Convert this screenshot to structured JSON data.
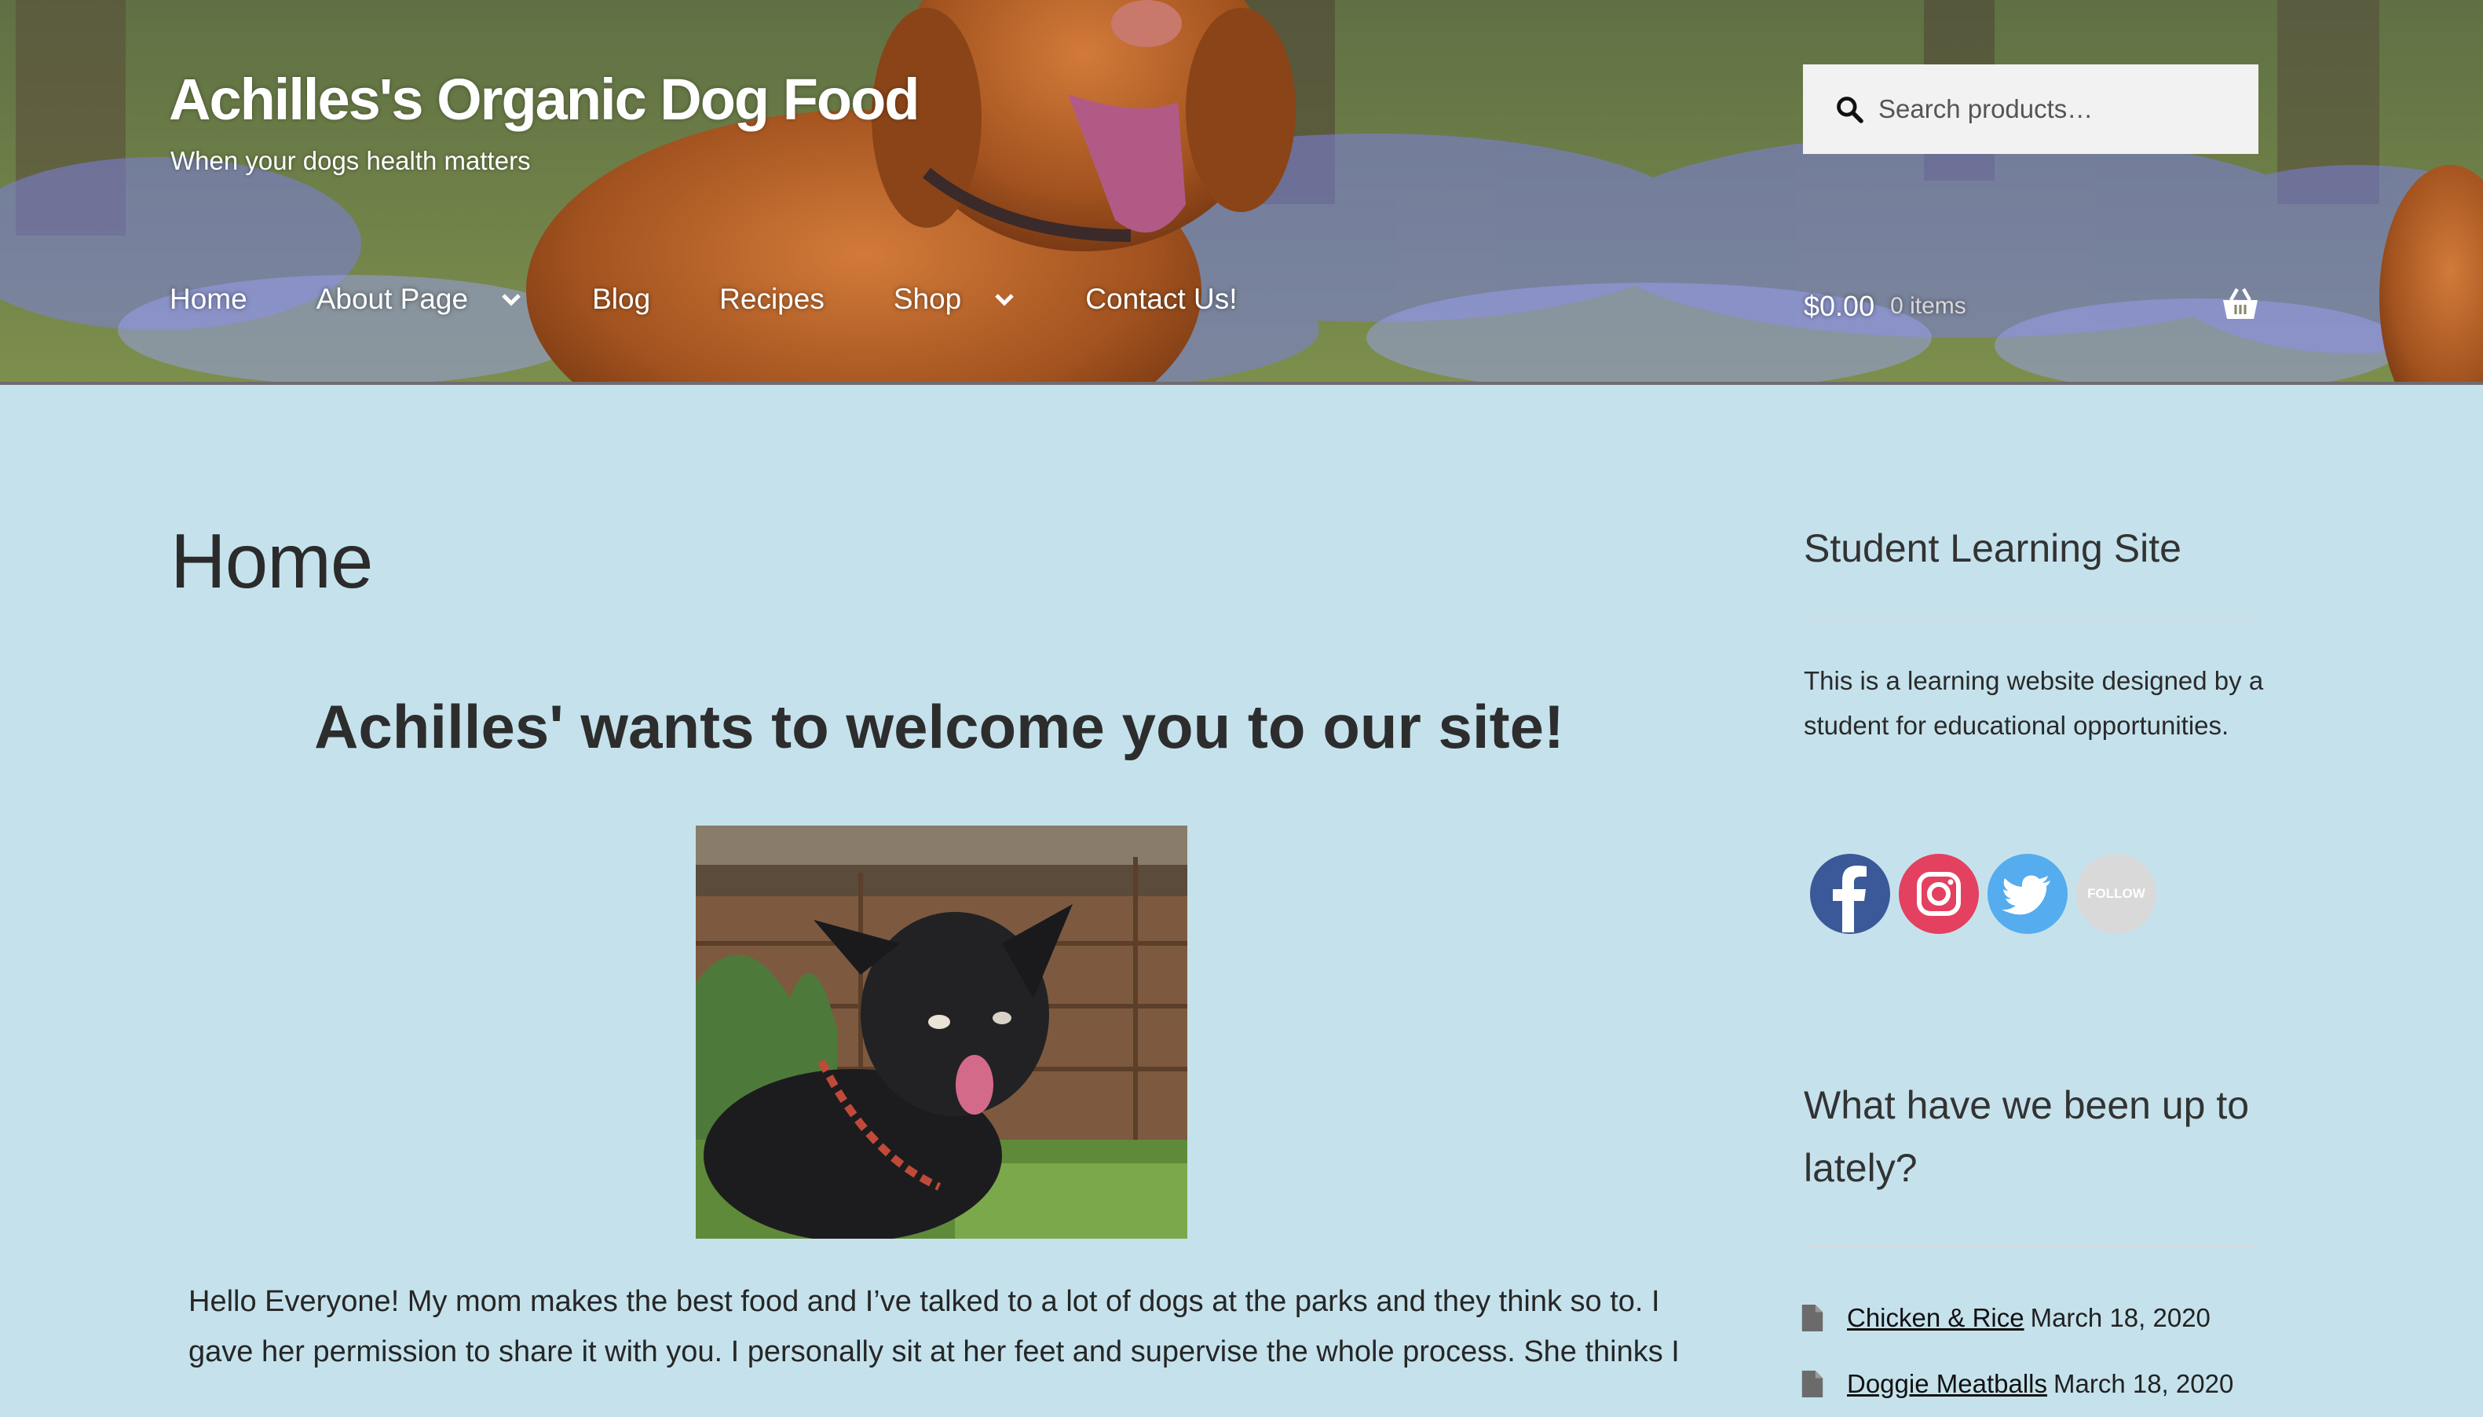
{
  "header": {
    "site_title": "Achilles's Organic Dog Food",
    "tagline": "When your dogs health matters",
    "search_placeholder": "Search products…",
    "nav": [
      {
        "label": "Home"
      },
      {
        "label": "About Page"
      },
      {
        "label": "Blog"
      },
      {
        "label": "Recipes"
      },
      {
        "label": "Shop"
      },
      {
        "label": "Contact Us!"
      }
    ],
    "cart": {
      "amount": "$0.00",
      "items": "0 items"
    }
  },
  "main": {
    "page_title": "Home",
    "welcome_heading": "Achilles' wants to welcome you to our site!",
    "body_text": "Hello Everyone! My mom makes the best food and I’ve talked to a lot of dogs at the parks and they think so to. I gave her permission to share it with you. I personally sit at her feet and supervise the whole process. She thinks I"
  },
  "sidebar": {
    "widget1_title": "Student Learning Site",
    "widget1_text": "This is a learning website designed by a student for educational opportunities.",
    "social": {
      "follow_label": "FOLLOW"
    },
    "widget2_title": "What have we been up to lately?",
    "posts": [
      {
        "title": "Chicken & Rice",
        "date": "March 18, 2020"
      },
      {
        "title": "Doggie Meatballs",
        "date": "March 18, 2020"
      }
    ]
  },
  "colors": {
    "page_bg": "#c5e2ec",
    "facebook": "#3b5998",
    "instagram": "#e4405f",
    "twitter": "#55acee"
  }
}
